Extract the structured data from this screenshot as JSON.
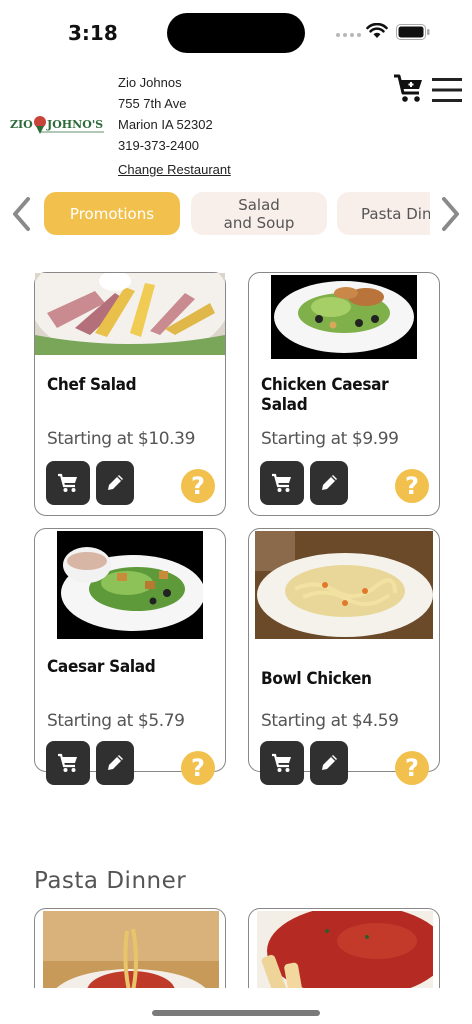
{
  "status_bar": {
    "time": "3:18"
  },
  "restaurant": {
    "logo_text": "ZIO JOHNO'S",
    "name": "Zio Johnos",
    "street": "755 7th Ave",
    "city": "Marion IA 52302",
    "phone": "319-373-2400",
    "change_label": "Change Restaurant"
  },
  "icons": {
    "cart": "cart-icon",
    "menu": "hamburger-menu-icon",
    "prev": "chevron-left-icon",
    "next": "chevron-right-icon",
    "add": "cart-icon",
    "edit": "pencil-icon",
    "help": "question-icon"
  },
  "categories": [
    {
      "label": "Promotions",
      "active": true
    },
    {
      "label": "Salad\nand Soup",
      "active": false
    },
    {
      "label": "Pasta Dinner",
      "active": false
    }
  ],
  "items": [
    {
      "name": "Chef Salad",
      "price": "Starting at $10.39"
    },
    {
      "name": "Chicken Caesar Salad",
      "price": "Starting at $9.99"
    },
    {
      "name": "Caesar Salad",
      "price": "Starting at $5.79"
    },
    {
      "name": "Bowl Chicken",
      "price": "Starting at $4.59"
    }
  ],
  "help_symbol": "?",
  "next_section": {
    "title": "Pasta Dinner"
  },
  "colors": {
    "accent": "#f2c04d",
    "button": "#303030",
    "inactive_tab": "#f8efea"
  }
}
